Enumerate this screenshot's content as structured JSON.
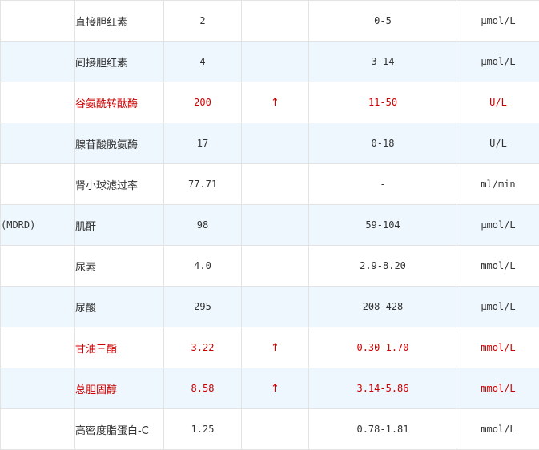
{
  "rows": [
    {
      "code": "",
      "name": "直接胆红素",
      "result": "2",
      "flag": "",
      "range": "0-5",
      "unit": "μmol/L",
      "abnormal": false
    },
    {
      "code": "",
      "name": "间接胆红素",
      "result": "4",
      "flag": "",
      "range": "3-14",
      "unit": "μmol/L",
      "abnormal": false
    },
    {
      "code": "",
      "name": "谷氨酰转酞酶",
      "result": "200",
      "flag": "↑",
      "range": "11-50",
      "unit": "U/L",
      "abnormal": true
    },
    {
      "code": "",
      "name": "腺苷酸脱氨酶",
      "result": "17",
      "flag": "",
      "range": "0-18",
      "unit": "U/L",
      "abnormal": false
    },
    {
      "code": "",
      "name": "肾小球滤过率",
      "result": "77.71",
      "flag": "",
      "range": "-",
      "unit": "ml/min",
      "abnormal": false
    },
    {
      "code": "(MDRD)",
      "name": "肌酐",
      "result": "98",
      "flag": "",
      "range": "59-104",
      "unit": "μmol/L",
      "abnormal": false
    },
    {
      "code": "",
      "name": "尿素",
      "result": "4.0",
      "flag": "",
      "range": "2.9-8.20",
      "unit": "mmol/L",
      "abnormal": false
    },
    {
      "code": "",
      "name": "尿酸",
      "result": "295",
      "flag": "",
      "range": "208-428",
      "unit": "μmol/L",
      "abnormal": false
    },
    {
      "code": "",
      "name": "甘油三酯",
      "result": "3.22",
      "flag": "↑",
      "range": "0.30-1.70",
      "unit": "mmol/L",
      "abnormal": true
    },
    {
      "code": "",
      "name": "总胆固醇",
      "result": "8.58",
      "flag": "↑",
      "range": "3.14-5.86",
      "unit": "mmol/L",
      "abnormal": true
    },
    {
      "code": "",
      "name": "高密度脂蛋白-C",
      "result": "1.25",
      "flag": "",
      "range": "0.78-1.81",
      "unit": "mmol/L",
      "abnormal": false
    }
  ]
}
